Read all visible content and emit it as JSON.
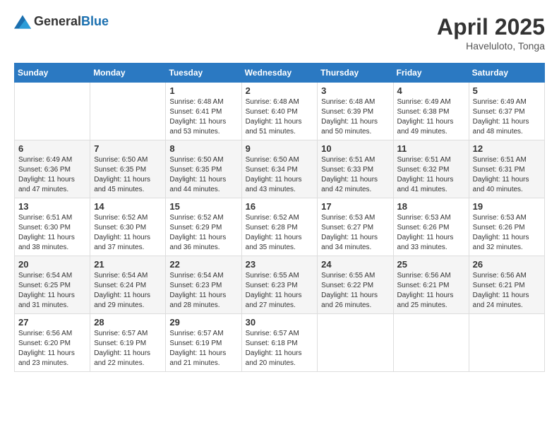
{
  "header": {
    "logo_general": "General",
    "logo_blue": "Blue",
    "title": "April 2025",
    "location": "Haveluloto, Tonga"
  },
  "calendar": {
    "days_of_week": [
      "Sunday",
      "Monday",
      "Tuesday",
      "Wednesday",
      "Thursday",
      "Friday",
      "Saturday"
    ],
    "weeks": [
      [
        {
          "day": "",
          "sunrise": "",
          "sunset": "",
          "daylight": ""
        },
        {
          "day": "",
          "sunrise": "",
          "sunset": "",
          "daylight": ""
        },
        {
          "day": "1",
          "sunrise": "Sunrise: 6:48 AM",
          "sunset": "Sunset: 6:41 PM",
          "daylight": "Daylight: 11 hours and 53 minutes."
        },
        {
          "day": "2",
          "sunrise": "Sunrise: 6:48 AM",
          "sunset": "Sunset: 6:40 PM",
          "daylight": "Daylight: 11 hours and 51 minutes."
        },
        {
          "day": "3",
          "sunrise": "Sunrise: 6:48 AM",
          "sunset": "Sunset: 6:39 PM",
          "daylight": "Daylight: 11 hours and 50 minutes."
        },
        {
          "day": "4",
          "sunrise": "Sunrise: 6:49 AM",
          "sunset": "Sunset: 6:38 PM",
          "daylight": "Daylight: 11 hours and 49 minutes."
        },
        {
          "day": "5",
          "sunrise": "Sunrise: 6:49 AM",
          "sunset": "Sunset: 6:37 PM",
          "daylight": "Daylight: 11 hours and 48 minutes."
        }
      ],
      [
        {
          "day": "6",
          "sunrise": "Sunrise: 6:49 AM",
          "sunset": "Sunset: 6:36 PM",
          "daylight": "Daylight: 11 hours and 47 minutes."
        },
        {
          "day": "7",
          "sunrise": "Sunrise: 6:50 AM",
          "sunset": "Sunset: 6:35 PM",
          "daylight": "Daylight: 11 hours and 45 minutes."
        },
        {
          "day": "8",
          "sunrise": "Sunrise: 6:50 AM",
          "sunset": "Sunset: 6:35 PM",
          "daylight": "Daylight: 11 hours and 44 minutes."
        },
        {
          "day": "9",
          "sunrise": "Sunrise: 6:50 AM",
          "sunset": "Sunset: 6:34 PM",
          "daylight": "Daylight: 11 hours and 43 minutes."
        },
        {
          "day": "10",
          "sunrise": "Sunrise: 6:51 AM",
          "sunset": "Sunset: 6:33 PM",
          "daylight": "Daylight: 11 hours and 42 minutes."
        },
        {
          "day": "11",
          "sunrise": "Sunrise: 6:51 AM",
          "sunset": "Sunset: 6:32 PM",
          "daylight": "Daylight: 11 hours and 41 minutes."
        },
        {
          "day": "12",
          "sunrise": "Sunrise: 6:51 AM",
          "sunset": "Sunset: 6:31 PM",
          "daylight": "Daylight: 11 hours and 40 minutes."
        }
      ],
      [
        {
          "day": "13",
          "sunrise": "Sunrise: 6:51 AM",
          "sunset": "Sunset: 6:30 PM",
          "daylight": "Daylight: 11 hours and 38 minutes."
        },
        {
          "day": "14",
          "sunrise": "Sunrise: 6:52 AM",
          "sunset": "Sunset: 6:30 PM",
          "daylight": "Daylight: 11 hours and 37 minutes."
        },
        {
          "day": "15",
          "sunrise": "Sunrise: 6:52 AM",
          "sunset": "Sunset: 6:29 PM",
          "daylight": "Daylight: 11 hours and 36 minutes."
        },
        {
          "day": "16",
          "sunrise": "Sunrise: 6:52 AM",
          "sunset": "Sunset: 6:28 PM",
          "daylight": "Daylight: 11 hours and 35 minutes."
        },
        {
          "day": "17",
          "sunrise": "Sunrise: 6:53 AM",
          "sunset": "Sunset: 6:27 PM",
          "daylight": "Daylight: 11 hours and 34 minutes."
        },
        {
          "day": "18",
          "sunrise": "Sunrise: 6:53 AM",
          "sunset": "Sunset: 6:26 PM",
          "daylight": "Daylight: 11 hours and 33 minutes."
        },
        {
          "day": "19",
          "sunrise": "Sunrise: 6:53 AM",
          "sunset": "Sunset: 6:26 PM",
          "daylight": "Daylight: 11 hours and 32 minutes."
        }
      ],
      [
        {
          "day": "20",
          "sunrise": "Sunrise: 6:54 AM",
          "sunset": "Sunset: 6:25 PM",
          "daylight": "Daylight: 11 hours and 31 minutes."
        },
        {
          "day": "21",
          "sunrise": "Sunrise: 6:54 AM",
          "sunset": "Sunset: 6:24 PM",
          "daylight": "Daylight: 11 hours and 29 minutes."
        },
        {
          "day": "22",
          "sunrise": "Sunrise: 6:54 AM",
          "sunset": "Sunset: 6:23 PM",
          "daylight": "Daylight: 11 hours and 28 minutes."
        },
        {
          "day": "23",
          "sunrise": "Sunrise: 6:55 AM",
          "sunset": "Sunset: 6:23 PM",
          "daylight": "Daylight: 11 hours and 27 minutes."
        },
        {
          "day": "24",
          "sunrise": "Sunrise: 6:55 AM",
          "sunset": "Sunset: 6:22 PM",
          "daylight": "Daylight: 11 hours and 26 minutes."
        },
        {
          "day": "25",
          "sunrise": "Sunrise: 6:56 AM",
          "sunset": "Sunset: 6:21 PM",
          "daylight": "Daylight: 11 hours and 25 minutes."
        },
        {
          "day": "26",
          "sunrise": "Sunrise: 6:56 AM",
          "sunset": "Sunset: 6:21 PM",
          "daylight": "Daylight: 11 hours and 24 minutes."
        }
      ],
      [
        {
          "day": "27",
          "sunrise": "Sunrise: 6:56 AM",
          "sunset": "Sunset: 6:20 PM",
          "daylight": "Daylight: 11 hours and 23 minutes."
        },
        {
          "day": "28",
          "sunrise": "Sunrise: 6:57 AM",
          "sunset": "Sunset: 6:19 PM",
          "daylight": "Daylight: 11 hours and 22 minutes."
        },
        {
          "day": "29",
          "sunrise": "Sunrise: 6:57 AM",
          "sunset": "Sunset: 6:19 PM",
          "daylight": "Daylight: 11 hours and 21 minutes."
        },
        {
          "day": "30",
          "sunrise": "Sunrise: 6:57 AM",
          "sunset": "Sunset: 6:18 PM",
          "daylight": "Daylight: 11 hours and 20 minutes."
        },
        {
          "day": "",
          "sunrise": "",
          "sunset": "",
          "daylight": ""
        },
        {
          "day": "",
          "sunrise": "",
          "sunset": "",
          "daylight": ""
        },
        {
          "day": "",
          "sunrise": "",
          "sunset": "",
          "daylight": ""
        }
      ]
    ]
  }
}
